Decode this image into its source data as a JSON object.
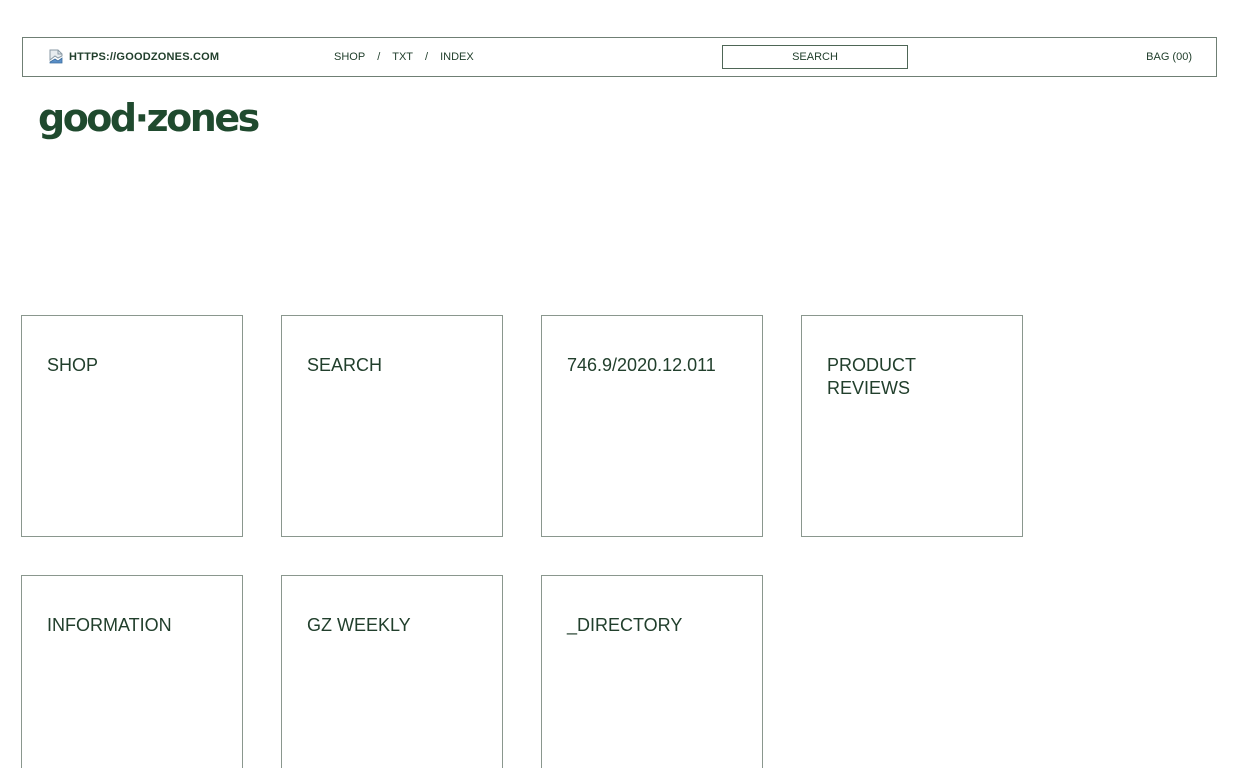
{
  "header": {
    "site_url": "HTTPS://GOODZONES.COM",
    "breadcrumbs": [
      "SHOP",
      "TXT",
      "INDEX"
    ],
    "separator": "/",
    "search_label": "SEARCH",
    "bag_label": "BAG (00)"
  },
  "logo": {
    "text": "good·zones"
  },
  "tiles": [
    {
      "label": "SHOP"
    },
    {
      "label": "SEARCH"
    },
    {
      "label": "746.9/2020.12.011"
    },
    {
      "label": "PRODUCT REVIEWS"
    },
    {
      "label": "INFORMATION"
    },
    {
      "label": "GZ WEEKLY"
    },
    {
      "label": "_DIRECTORY"
    }
  ],
  "colors": {
    "text": "#213f2c",
    "logo": "#1f4a2e",
    "border": "#8a978e",
    "background": "#ffffff"
  },
  "icons": {
    "site_icon": "broken-image-icon"
  }
}
